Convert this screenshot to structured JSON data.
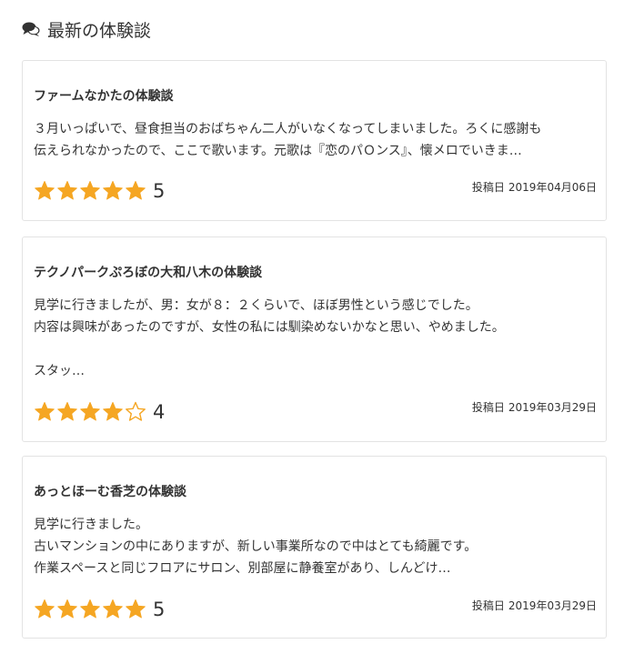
{
  "section": {
    "title": "最新の体験談",
    "icon": "comments-icon"
  },
  "colors": {
    "star": "#f5a623",
    "border": "#e3e3e3",
    "text": "#333333"
  },
  "post_label": "投稿日",
  "reviews": [
    {
      "title": "ファームなかたの体験談",
      "excerpt": "３月いっぱいで、昼食担当のおばちゃん二人がいなくなってしまいました。ろくに感謝も\n伝えられなかったので、ここで歌います。元歌は『恋のパＯンス』、懐メロでいきま…",
      "rating": 5,
      "rating_label": "5",
      "date": "2019年04月06日"
    },
    {
      "title": "テクノパークぷろぼの大和八木の体験談",
      "excerpt": "見学に行きましたが、男：女が８：２くらいで、ほぼ男性という感じでした。\n内容は興味があったのですが、女性の私には馴染めないかなと思い、やめました。\n\nスタッ…",
      "rating": 4,
      "rating_label": "4",
      "date": "2019年03月29日"
    },
    {
      "title": "あっとほーむ香芝の体験談",
      "excerpt": "見学に行きました。\n古いマンションの中にありますが、新しい事業所なので中はとても綺麗です。\n作業スペースと同じフロアにサロン、別部屋に静養室があり、しんどけ…",
      "rating": 5,
      "rating_label": "5",
      "date": "2019年03月29日"
    }
  ]
}
